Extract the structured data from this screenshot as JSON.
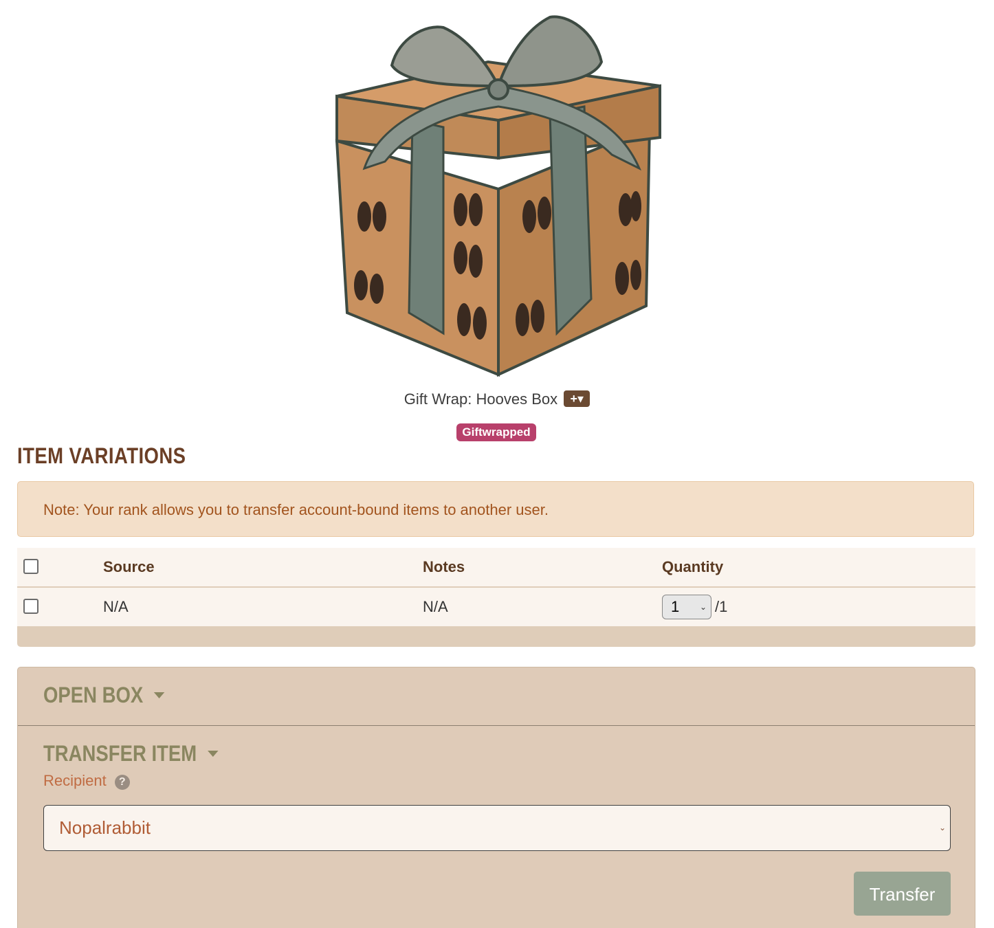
{
  "item": {
    "name": "Gift Wrap: Hooves Box",
    "add_button_label": "+▾",
    "badge": "Giftwrapped",
    "image_icon": "gift-box-hooves"
  },
  "variations": {
    "title": "ITEM VARIATIONS",
    "note": "Note: Your rank allows you to transfer account-bound items to another user.",
    "columns": [
      "Source",
      "Notes",
      "Quantity"
    ],
    "rows": [
      {
        "source": "N/A",
        "notes": "N/A",
        "quantity_selected": "1",
        "quantity_max": "/1"
      }
    ]
  },
  "actions": {
    "open_box_label": "OPEN BOX",
    "transfer_label": "TRANSFER ITEM",
    "recipient_label": "Recipient",
    "help_icon": "?",
    "recipient_value": "Nopalrabbit",
    "transfer_button": "Transfer"
  },
  "colors": {
    "heading": "#6b3f26",
    "badge": "#b8406b",
    "accent_olive": "#8a8660",
    "button": "#98a593"
  }
}
